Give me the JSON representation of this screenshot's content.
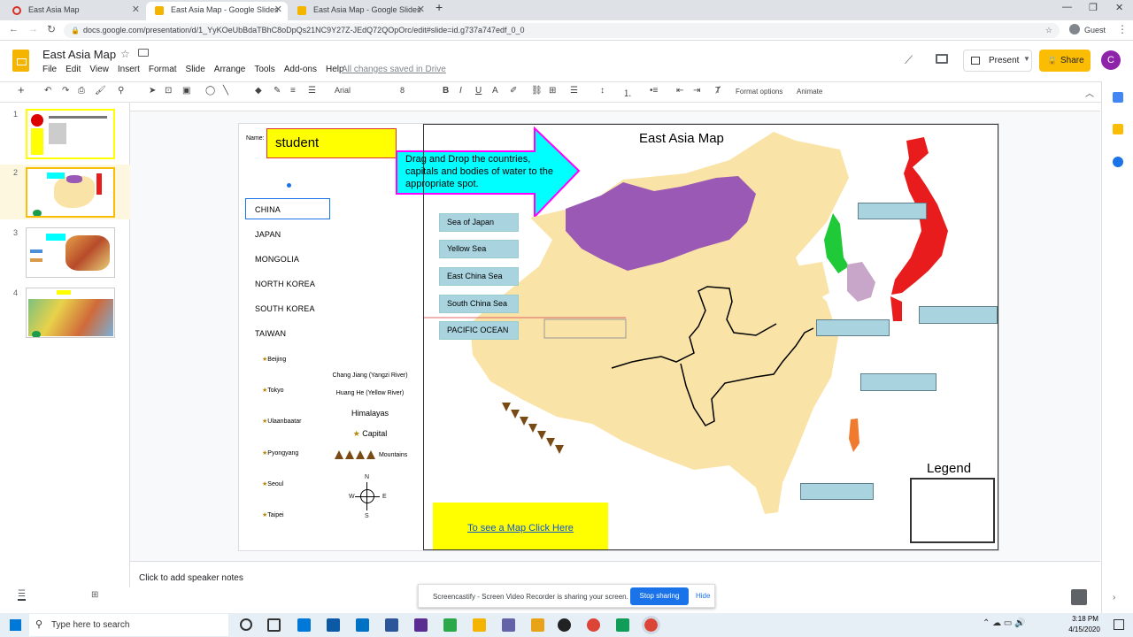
{
  "browser": {
    "tabs": [
      {
        "title": "East Asia Map",
        "active": false
      },
      {
        "title": "East Asia Map - Google Slides",
        "active": true
      },
      {
        "title": "East Asia Map - Google Slides",
        "active": false
      }
    ],
    "url": "docs.google.com/presentation/d/1_YyKOeUbBdaTBhC8oDpQs21NC9Y27Z-JEdQ72QOpOrc/edit#slide=id.g737a747edf_0_0",
    "profile_label": "Guest"
  },
  "app": {
    "title": "East Asia Map",
    "menu": [
      "File",
      "Edit",
      "View",
      "Insert",
      "Format",
      "Slide",
      "Arrange",
      "Tools",
      "Add-ons",
      "Help"
    ],
    "save_status": "All changes saved in Drive",
    "present_label": "Present",
    "share_label": "Share",
    "avatar_letter": "C"
  },
  "toolbar": {
    "font": "Arial",
    "font_size": "8",
    "format_options": "Format options",
    "animate": "Animate"
  },
  "filmstrip": {
    "slides": [
      "1",
      "2",
      "3",
      "4"
    ],
    "selected": "2"
  },
  "slide": {
    "name_label": "Name:",
    "name_value": "student",
    "instructions": "Drag and Drop the countries, capitals and bodies of water to the appropriate spot.",
    "map_title": "East Asia Map",
    "countries": [
      "CHINA",
      "JAPAN",
      "MONGOLIA",
      "NORTH KOREA",
      "SOUTH KOREA",
      "TAIWAN"
    ],
    "bodies_of_water": [
      "Sea of Japan",
      "Yellow Sea",
      "East China Sea",
      "South China Sea",
      "PACIFIC OCEAN"
    ],
    "capitals": [
      "Beijing",
      "Tokyo",
      "Ulaanbaatar",
      "Pyongyang",
      "Seoul",
      "Taipei"
    ],
    "rivers": [
      "Chang Jiang (Yangzi River)",
      "Huang He (Yellow River)"
    ],
    "himalayas": "Himalayas",
    "capital_key": "Capital",
    "mountains_key": "Mountains",
    "compass": {
      "n": "N",
      "s": "S",
      "e": "E",
      "w": "W"
    },
    "map_link": "To see a Map Click Here",
    "legend_title": "Legend",
    "colors": {
      "name_box": "#ffff00",
      "arrow": "#00ffff",
      "arrow_border": "#ff00ff",
      "land": "#fae3a6",
      "mongolia": "#9b59b6",
      "japan": "#e81c1c",
      "north_korea": "#1fc938",
      "south_korea": "#c7a6c9",
      "taiwan": "#f07a2e",
      "water_box": "#a8d3df",
      "link_box": "#ffff00"
    }
  },
  "notes": {
    "placeholder": "Click to add speaker notes"
  },
  "share_notice": {
    "text": "Screencastify - Screen Video Recorder is sharing your screen.",
    "stop": "Stop sharing",
    "hide": "Hide"
  },
  "taskbar": {
    "search_placeholder": "Type here to search",
    "time": "3:18 PM",
    "date": "4/15/2020"
  }
}
